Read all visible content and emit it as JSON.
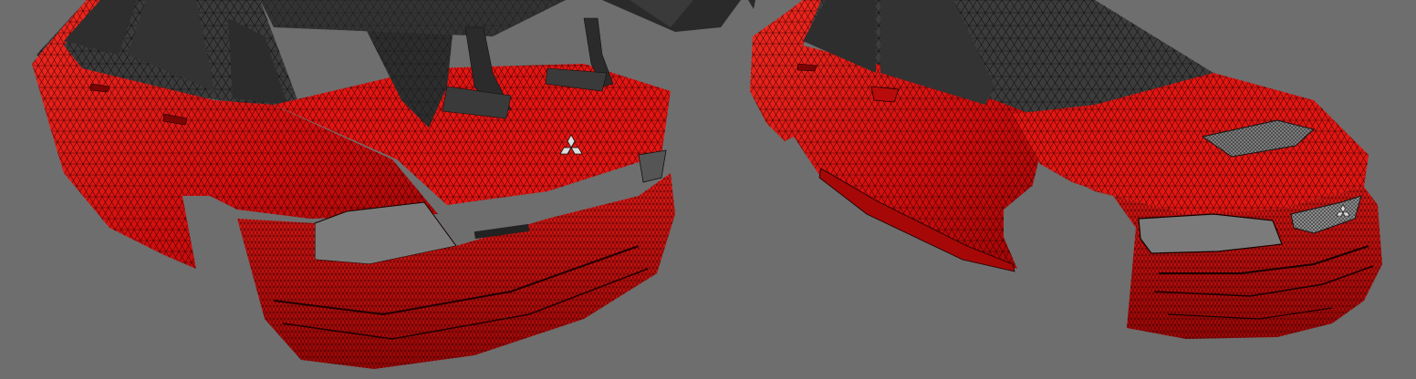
{
  "scene": {
    "background": "#6e6e6e",
    "body_color": "#d90f0f",
    "body_color_dark": "#a50808",
    "body_color_light": "#ee2a22",
    "wire_color": "#1a0000",
    "spoiler_color": "#2b2b2b",
    "glass_color": "#3a3a3a",
    "light_cavity_color": "#7a7a7a",
    "objects": [
      {
        "name": "rear-view-car-body",
        "icon": "sedan-rear-wireframe"
      },
      {
        "name": "front-view-car-body",
        "icon": "sedan-front-wireframe"
      }
    ]
  }
}
